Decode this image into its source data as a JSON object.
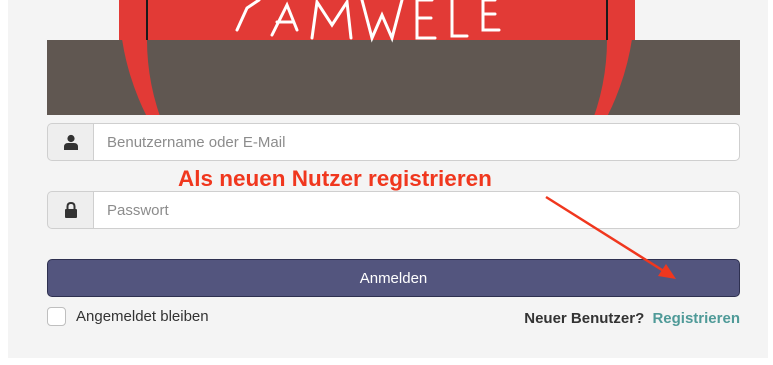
{
  "colors": {
    "logo_red": "#e23a36",
    "banner_bg": "#605751",
    "panel_bg": "#f4f4f4",
    "button_bg": "#53557e",
    "annotation": "#f0371e",
    "link": "#4f9a98"
  },
  "login_form": {
    "username": {
      "placeholder": "Benutzername oder E-Mail",
      "value": "",
      "icon": "user-icon"
    },
    "password": {
      "placeholder": "Passwort",
      "value": "",
      "icon": "lock-icon"
    },
    "submit_label": "Anmelden",
    "remember_me": {
      "label": "Angemeldet bleiben",
      "checked": false
    },
    "new_user_text": "Neuer Benutzer?",
    "register_link": "Registrieren"
  },
  "annotation": {
    "text": "Als neuen Nutzer registrieren"
  }
}
